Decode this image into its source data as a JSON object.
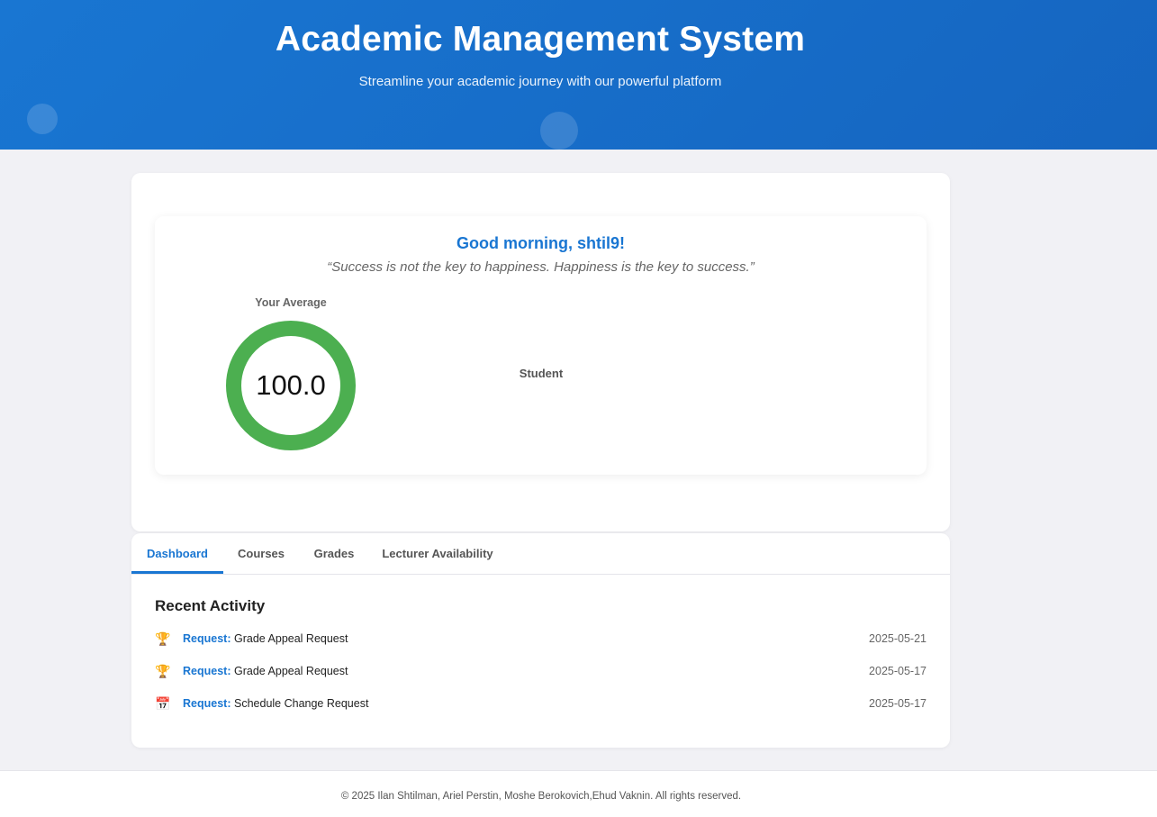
{
  "header": {
    "title": "Academic Management System",
    "subtitle": "Streamline your academic journey with our powerful platform"
  },
  "welcome": {
    "greeting": "Good morning, shtil9!",
    "quote": "“Success is not the key to happiness. Happiness is the key to success.”",
    "average_label": "Your Average",
    "average_value": "100.0",
    "role": "Student",
    "accent_color": "#4caf50"
  },
  "tabs": [
    {
      "label": "Dashboard",
      "active": true
    },
    {
      "label": "Courses",
      "active": false
    },
    {
      "label": "Grades",
      "active": false
    },
    {
      "label": "Lecturer Availability",
      "active": false
    }
  ],
  "recent_activity": {
    "title": "Recent Activity",
    "items": [
      {
        "icon": "trophy-icon",
        "kind": "Request:",
        "description": "Grade Appeal Request",
        "date": "2025-05-21"
      },
      {
        "icon": "trophy-icon",
        "kind": "Request:",
        "description": "Grade Appeal Request",
        "date": "2025-05-17"
      },
      {
        "icon": "calendar-icon",
        "kind": "Request:",
        "description": "Schedule Change Request",
        "date": "2025-05-17"
      }
    ]
  },
  "footer": {
    "text": "© 2025 Ilan Shtilman, Ariel Perstin, Moshe Berokovich,Ehud Vaknin. All rights reserved."
  },
  "colors": {
    "primary": "#1976d2",
    "success": "#4caf50",
    "background": "#f1f1f5"
  }
}
